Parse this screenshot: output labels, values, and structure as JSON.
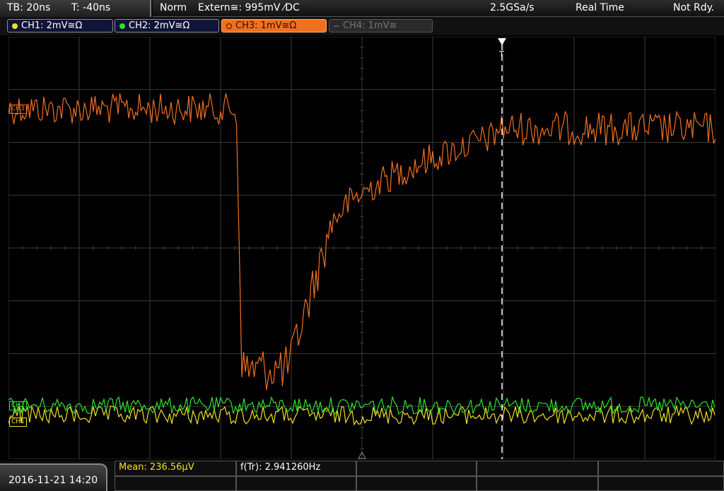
{
  "status": {
    "timebase": "TB: 20ns",
    "trigger_time": "T: -40ns",
    "mode": "Norm",
    "trigger_source": "Extern≅: 995mV ⁄DC",
    "sample_rate": "2.5GSa/s",
    "acquisition": "Real Time",
    "ready_state": "Not Rdy."
  },
  "channels": [
    {
      "label": "CH1: 2mV≅Ω",
      "color": "#f0e020",
      "state": "on"
    },
    {
      "label": "CH2: 2mV≅Ω",
      "color": "#30e030",
      "state": "on"
    },
    {
      "label": "CH3: 1mV≅Ω",
      "color": "#f07020",
      "state": "selected"
    },
    {
      "label": "CH4: 1mV≅",
      "color": "#777777",
      "state": "off"
    }
  ],
  "markers": {
    "ch3": "CH3",
    "ch2": "CH2",
    "ch1": "CH1",
    "trigger": "T"
  },
  "footer": {
    "datetime": "2016-11-21 14:20",
    "mean": "Mean: 236.56µV",
    "freq": "f(Tr): 2.941260Hz"
  },
  "colors": {
    "ch1": "#f0e020",
    "ch2": "#30e030",
    "ch3": "#f07020",
    "grid": "#3a3a3a"
  }
}
